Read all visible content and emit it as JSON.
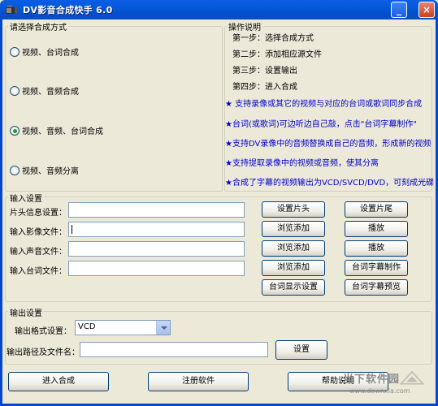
{
  "window": {
    "title": "DV影音合成快手 6.0",
    "minimize_label": "_",
    "close_label": "×"
  },
  "synth_mode": {
    "group_label": "请选择合成方式",
    "options": [
      {
        "label": "视频、台词合成",
        "checked": false
      },
      {
        "label": "视频、音频合成",
        "checked": false
      },
      {
        "label": "视频、音频、台词合成",
        "checked": true
      },
      {
        "label": "视频、音频分离",
        "checked": false
      }
    ]
  },
  "instructions": {
    "group_label": "操作说明",
    "steps": [
      "第一步：选择合成方式",
      "第二步：添加相应源文件",
      "第三步：设置输出",
      "第四步：进入合成"
    ],
    "features": [
      "★ 支持录像或其它的视频与对应的台词或歌词同步合成",
      "★台词(或歌词)可边听边自己敲，点击\"台词字幕制作\"",
      "★支持DV录像中的音频替换成自己的音频，形成新的视频",
      "★支持提取录像中的视频或音频，使其分离",
      "★合成了字幕的视频输出为VCD/SVCD/DVD，可刻成光碟"
    ]
  },
  "input_settings": {
    "group_label": "输入设置",
    "fields": [
      {
        "label": "片头信息设置：",
        "value": ""
      },
      {
        "label": "输入影像文件：",
        "value": ""
      },
      {
        "label": "输入声音文件：",
        "value": ""
      },
      {
        "label": "输入台词文件：",
        "value": ""
      }
    ],
    "buttons": {
      "set_opening": "设置片头",
      "set_ending": "设置片尾",
      "browse_video": "浏览添加",
      "play_video": "播放",
      "browse_audio": "浏览添加",
      "play_audio": "播放",
      "browse_lyrics": "浏览添加",
      "make_subtitles": "台词字幕制作",
      "lyric_display_settings": "台词显示设置",
      "preview_subtitles": "台词字幕预览"
    }
  },
  "output_settings": {
    "group_label": "输出设置",
    "format_label": "输出格式设置：",
    "format_value": "VCD",
    "path_label": "输出路径及文件名：",
    "path_value": "",
    "set_button": "设置"
  },
  "footer": {
    "start_button": "进入合成",
    "register_button": "注册软件",
    "help_button": "帮助说明"
  },
  "watermark": {
    "text": "当下软件园",
    "url": "www.downxia.com"
  },
  "colors": {
    "titlebar": "#0A5EE6",
    "feature_text": "#0000CC",
    "window_bg": "#ECE9D8"
  }
}
